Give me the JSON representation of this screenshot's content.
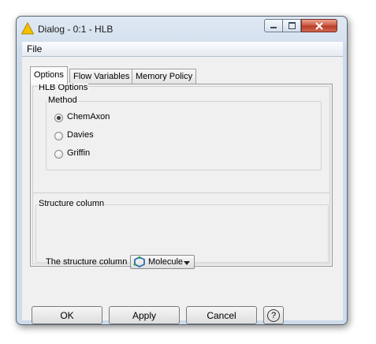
{
  "window": {
    "title": "Dialog - 0:1 - HLB"
  },
  "menu": {
    "file": "File"
  },
  "tabs": [
    {
      "label": "Options",
      "active": true
    },
    {
      "label": "Flow Variables",
      "active": false
    },
    {
      "label": "Memory Policy",
      "active": false
    }
  ],
  "hlb_options": {
    "title": "HLB Options",
    "method": {
      "title": "Method",
      "selected": "ChemAxon",
      "options": [
        "ChemAxon",
        "Davies",
        "Griffin"
      ]
    }
  },
  "structure": {
    "title": "Structure column",
    "label": "The structure column",
    "selected": "Molecule"
  },
  "buttons": {
    "ok": "OK",
    "apply": "Apply",
    "cancel": "Cancel",
    "help": "?"
  },
  "colors": {
    "warning_icon": "#f2c200",
    "close_button": "#c9553e"
  }
}
